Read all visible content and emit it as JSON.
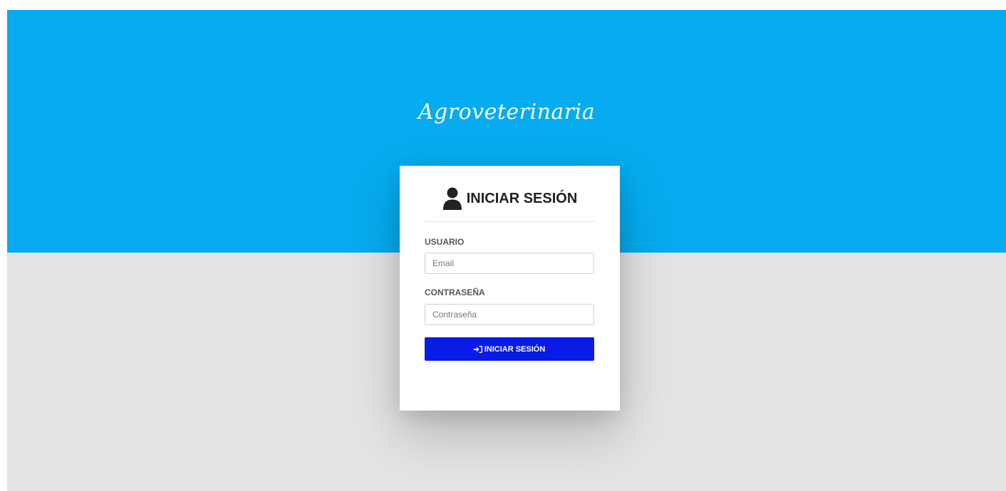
{
  "brand": {
    "title": "Agroveterinaria"
  },
  "login": {
    "heading": "INICIAR SESIÓN",
    "heading_icon": "user-icon",
    "username_label": "USUARIO",
    "username_placeholder": "Email",
    "username_value": "",
    "password_label": "CONTRASEÑA",
    "password_placeholder": "Contraseña",
    "password_value": "",
    "submit_label": "INICIAR SESIÓN",
    "submit_icon": "sign-in-icon"
  },
  "colors": {
    "hero_background": "#06acef",
    "lower_background": "#e4e4e4",
    "button_background": "#0a1be8",
    "card_background": "#ffffff"
  }
}
